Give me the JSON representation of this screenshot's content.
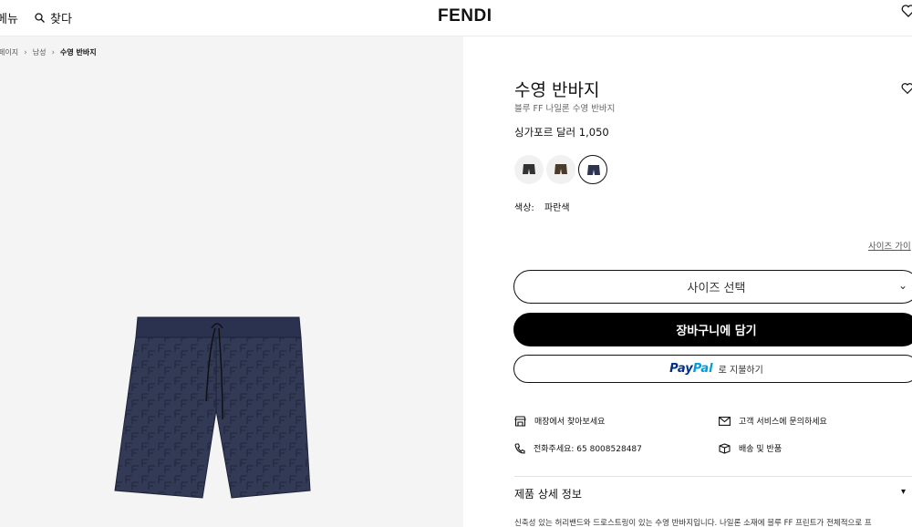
{
  "header": {
    "menu_label": "메뉴",
    "search_label": "찾다",
    "logo": "FENDI"
  },
  "breadcrumb": [
    "페이지",
    "남성",
    "수영 반바지"
  ],
  "product": {
    "title": "수영 반바지",
    "subtitle": "블루 FF 나일론 수영 반바지",
    "price": "싱가포르 달러 1,050",
    "color_label": "색상:",
    "color_value": "파란색",
    "swatches": [
      "black",
      "brown",
      "blue"
    ],
    "selected_swatch": "blue"
  },
  "actions": {
    "size_guide": "사이즈 가이",
    "size_select": "사이즈 선택",
    "add_to_cart": "장바구니에 담기",
    "paypal_pay": "Pay",
    "paypal_pal": "Pal",
    "paypal_text": "로 지불하기"
  },
  "services": {
    "store": "매장에서 찾아보세요",
    "phone": "전화주세요: 65 8008528487",
    "mail": "고객 서비스에 문의하세요",
    "shipping": "배송 및 반품"
  },
  "details": {
    "title": "제품 상세 정보",
    "text": "신축성 있는 허리밴드와 드로스트링이 있는 수영 반바지입니다. 나일론 소재에 블루 FF 프린트가 전체적으로 프"
  },
  "colors": {
    "primary_text": "#111111",
    "left_bg": "#f4f4f4",
    "shorts_navy": "#2e3550",
    "paypal_dark": "#003087",
    "paypal_light": "#009cde"
  }
}
